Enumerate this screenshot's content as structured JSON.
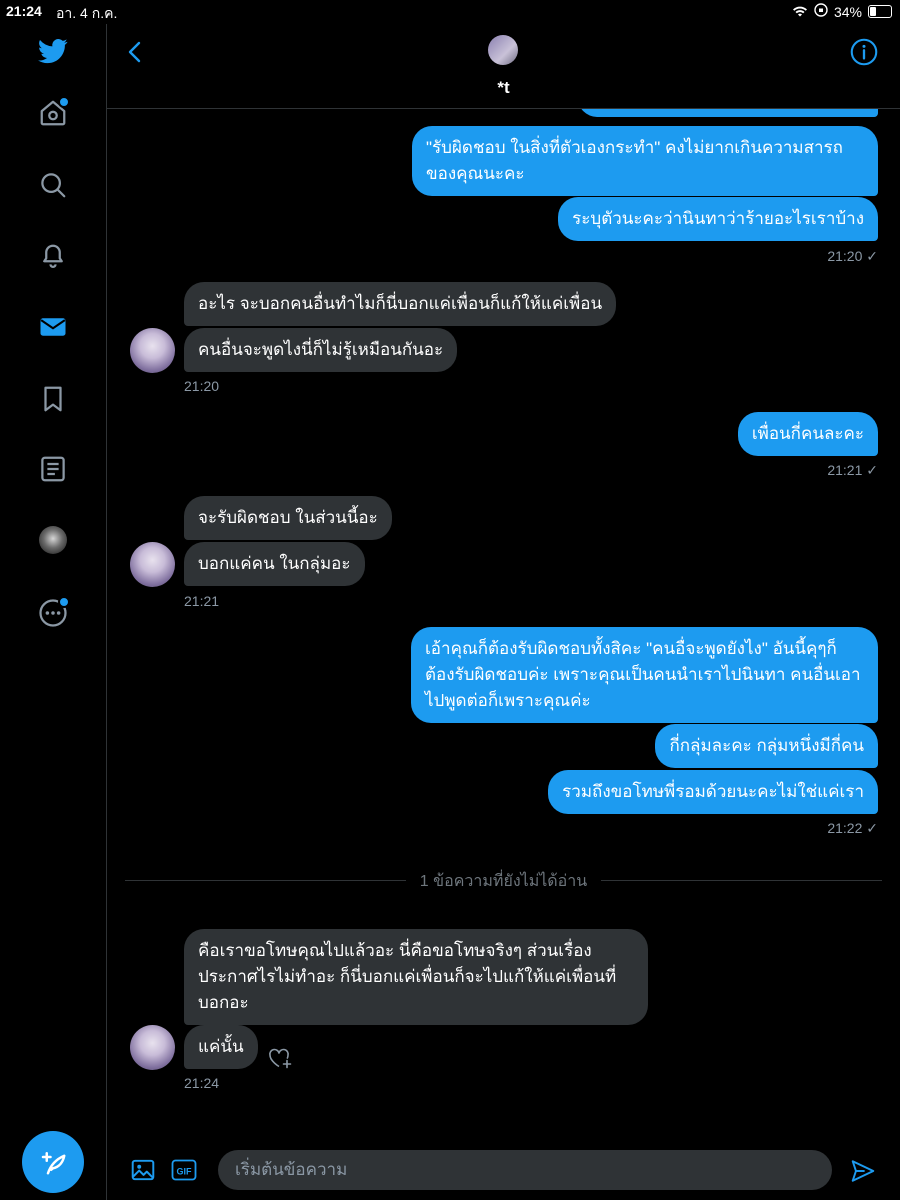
{
  "status_bar": {
    "time": "21:24",
    "date": "อา. 4 ก.ค.",
    "battery": "34%"
  },
  "colors": {
    "accent": "#1d9bf0",
    "incoming_bubble": "#2f3336",
    "background": "#000000",
    "muted": "#8b98a5"
  },
  "sidebar": {
    "items": [
      {
        "name": "twitter-logo",
        "icon": "bird"
      },
      {
        "name": "home",
        "icon": "home",
        "notification_dot": true
      },
      {
        "name": "explore",
        "icon": "search"
      },
      {
        "name": "notifications",
        "icon": "bell"
      },
      {
        "name": "messages",
        "icon": "mail",
        "active": true
      },
      {
        "name": "bookmarks",
        "icon": "bookmark"
      },
      {
        "name": "lists",
        "icon": "list"
      },
      {
        "name": "profile",
        "icon": "avatar"
      },
      {
        "name": "more",
        "icon": "ellipsis",
        "notification_dot": true
      }
    ],
    "compose_icon": "feather-plus"
  },
  "header": {
    "name": "*t"
  },
  "messages": {
    "m1": "\"รับผิดชอบ ในสิ่งที่ตัวเองกระทำ\" คงไม่ยากเกินความสารถของคุณนะคะ",
    "m2": "ระบุตัวนะคะว่านินทาว่าร้ายอะไรเราบ้าง",
    "t1": "21:20 ✓",
    "m3": "อะไร จะบอกคนอื่นทำไมก็นี่บอกแค่เพื่อนก็แก้ให้แค่เพื่อน",
    "m4": "คนอื่นจะพูดไงนี่ก็ไม่รู้เหมือนกันอะ",
    "t2": "21:20",
    "m5": "เพื่อนกี่คนละคะ",
    "t3": "21:21 ✓",
    "m6": "จะรับผิดชอบ ในส่วนนี้อะ",
    "m7": "บอกแค่คน ในกลุ่มอะ",
    "t4": "21:21",
    "m8": "เอ้าคุณก็ต้องรับผิดชอบทั้งสิคะ \"คนอื่จะพูดยังไง\" อันนี้คุๆก็ต้องรับผิดชอบค่ะ เพราะคุณเป็นคนนำเราไปนินทา คนอื่นเอาไปพูดต่อก็เพราะคุณค่ะ",
    "m9": "กี่กลุ่มละคะ กลุ่มหนึ่งมีกี่คน",
    "m10": "รวมถึงขอโทษพี่รอมด้วยนะคะไม่ใช่แค่เรา",
    "t5": "21:22 ✓",
    "unread": "1 ข้อความที่ยังไม่ได้อ่าน",
    "m11": "คือเราขอโทษคุณไปแล้วอะ นี่คือขอโทษจริงๆ ส่วนเรื่องประกาศไรไม่ทำอะ ก็นี่บอกแค่เพื่อนก็จะไปแก้ให้แค่เพื่อนที่บอกอะ",
    "m12": "แค่นั้น",
    "t6": "21:24"
  },
  "composer": {
    "placeholder": "เริ่มต้นข้อความ",
    "gif_label": "GIF"
  }
}
